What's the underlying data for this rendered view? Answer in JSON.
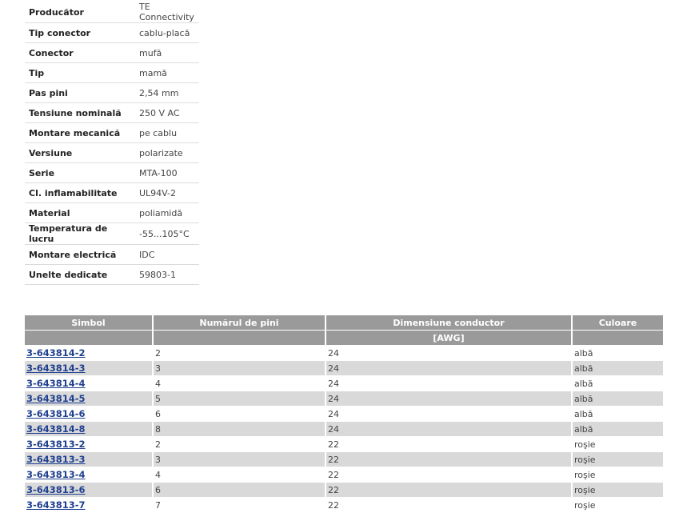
{
  "specs": [
    {
      "label": "Producător",
      "value": "TE Connectivity"
    },
    {
      "label": "Tip conector",
      "value": "cablu-placă"
    },
    {
      "label": "Conector",
      "value": "mufă"
    },
    {
      "label": "Tip",
      "value": "mamă"
    },
    {
      "label": "Pas pini",
      "value": "2,54 mm"
    },
    {
      "label": "Tensiune nominală",
      "value": "250 V AC"
    },
    {
      "label": "Montare mecanică",
      "value": "pe cablu"
    },
    {
      "label": "Versiune",
      "value": "polarizate"
    },
    {
      "label": "Serie",
      "value": "MTA-100"
    },
    {
      "label": "Cl. inflamabilitate",
      "value": "UL94V-2"
    },
    {
      "label": "Material",
      "value": "poliamidă"
    },
    {
      "label": "Temperatura de lucru",
      "value": "-55...105°C"
    },
    {
      "label": "Montare electrică",
      "value": "IDC"
    },
    {
      "label": "Unelte dedicate",
      "value": "59803-1"
    }
  ],
  "products": {
    "headers": {
      "symbol": "Simbol",
      "pins": "Numărul de pini",
      "conductor": "Dimensiune conductor",
      "conductor_unit": "[AWG]",
      "color": "Culoare"
    },
    "rows": [
      {
        "symbol": "3-643814-2",
        "pins": "2",
        "awg": "24",
        "color": "albă"
      },
      {
        "symbol": "3-643814-3",
        "pins": "3",
        "awg": "24",
        "color": "albă"
      },
      {
        "symbol": "3-643814-4",
        "pins": "4",
        "awg": "24",
        "color": "albă"
      },
      {
        "symbol": "3-643814-5",
        "pins": "5",
        "awg": "24",
        "color": "albă"
      },
      {
        "symbol": "3-643814-6",
        "pins": "6",
        "awg": "24",
        "color": "albă"
      },
      {
        "symbol": "3-643814-8",
        "pins": "8",
        "awg": "24",
        "color": "albă"
      },
      {
        "symbol": "3-643813-2",
        "pins": "2",
        "awg": "22",
        "color": "roşie"
      },
      {
        "symbol": "3-643813-3",
        "pins": "3",
        "awg": "22",
        "color": "roşie"
      },
      {
        "symbol": "3-643813-4",
        "pins": "4",
        "awg": "22",
        "color": "roşie"
      },
      {
        "symbol": "3-643813-6",
        "pins": "6",
        "awg": "22",
        "color": "roşie"
      },
      {
        "symbol": "3-643813-7",
        "pins": "7",
        "awg": "22",
        "color": "roşie"
      }
    ]
  }
}
